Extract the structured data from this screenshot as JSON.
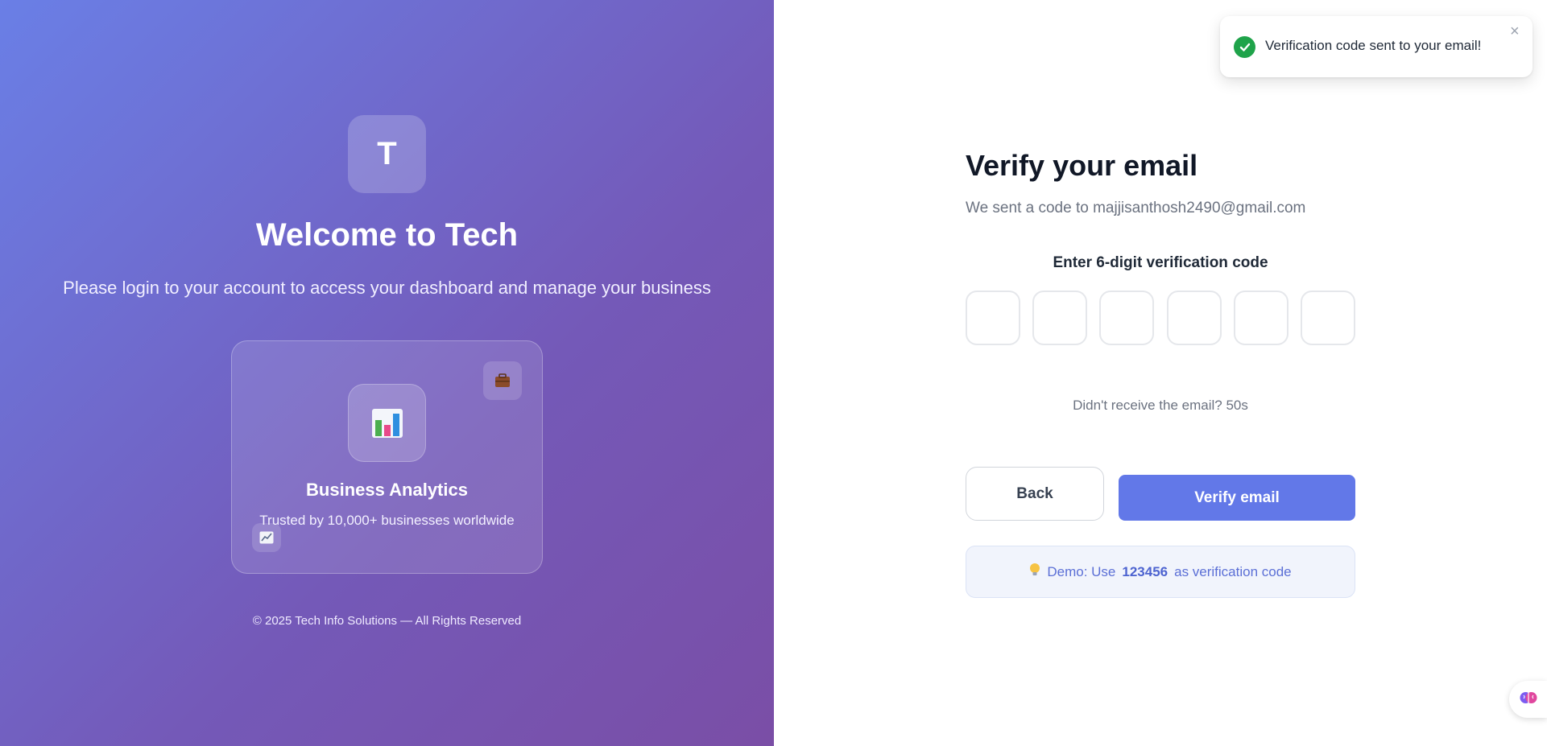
{
  "brand": {
    "logo_letter": "T",
    "welcome_title": "Welcome to Tech",
    "subtitle": "Please login to your account to access your dashboard and manage your business",
    "copyright": "© 2025 Tech Info Solutions — All Rights Reserved"
  },
  "feature_card": {
    "title": "Business Analytics",
    "text": "Trusted by 10,000+ businesses worldwide",
    "icons": [
      "briefcase-icon",
      "bar-chart-icon",
      "trend-chart-icon"
    ]
  },
  "verify": {
    "title": "Verify your email",
    "sent_text": "We sent a code to majjisanthosh2490@gmail.com",
    "code_label": "Enter 6-digit verification code",
    "code_digits": [
      "",
      "",
      "",
      "",
      "",
      ""
    ],
    "resend_text": "Didn't receive the email? 50s",
    "back_label": "Back",
    "verify_label": "Verify email",
    "demo_prefix": "Demo: Use",
    "demo_code": "123456",
    "demo_suffix": "as verification code"
  },
  "toast": {
    "message": "Verification code sent to your email!",
    "close": "×"
  },
  "colors": {
    "accent": "#6278e8",
    "gradient_start": "#6a7fe6",
    "gradient_end": "#7a4ea6",
    "success": "#1fa34a"
  }
}
